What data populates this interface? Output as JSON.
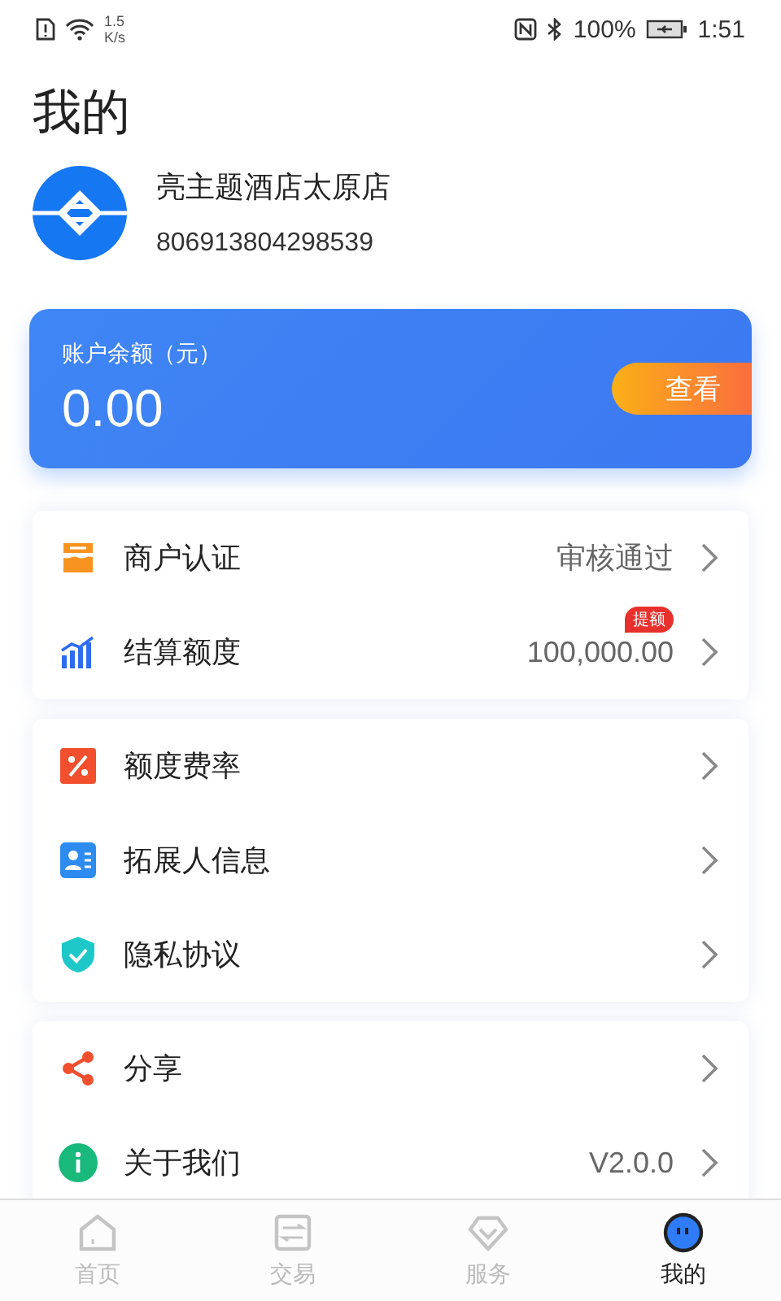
{
  "status_bar": {
    "speed_value": "1.5",
    "speed_unit": "K/s",
    "battery": "100%",
    "time": "1:51"
  },
  "page_title": "我的",
  "merchant": {
    "name": "亮主题酒店太原店",
    "id": "806913804298539"
  },
  "balance": {
    "label": "账户余额（元）",
    "amount": "0.00",
    "button": "查看"
  },
  "menu_groups": [
    {
      "items": [
        {
          "kind": "store",
          "label": "商户认证",
          "value": "审核通过"
        },
        {
          "kind": "chart",
          "label": "结算额度",
          "value": "100,000.00",
          "badge": "提额"
        }
      ]
    },
    {
      "items": [
        {
          "kind": "percent",
          "label": "额度费率"
        },
        {
          "kind": "contact",
          "label": "拓展人信息"
        },
        {
          "kind": "shield",
          "label": "隐私协议"
        }
      ]
    },
    {
      "items": [
        {
          "kind": "share",
          "label": "分享"
        },
        {
          "kind": "info",
          "label": "关于我们",
          "value": "V2.0.0"
        }
      ]
    }
  ],
  "tab_bar": [
    {
      "kind": "home",
      "label": "首页",
      "selected": false
    },
    {
      "kind": "swap",
      "label": "交易",
      "selected": false
    },
    {
      "kind": "diamond",
      "label": "服务",
      "selected": false
    },
    {
      "kind": "face",
      "label": "我的",
      "selected": true
    }
  ]
}
